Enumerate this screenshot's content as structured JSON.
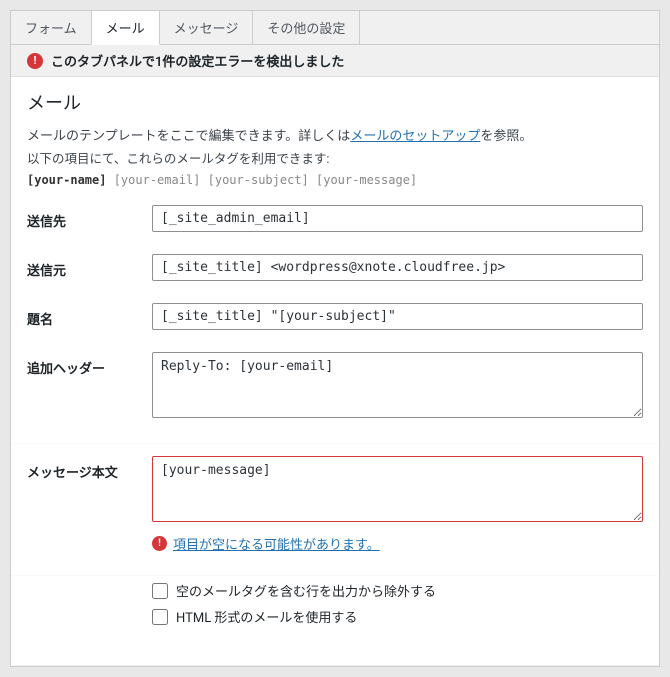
{
  "tabs": {
    "form": "フォーム",
    "mail": "メール",
    "messages": "メッセージ",
    "other": "その他の設定"
  },
  "alert": {
    "text": "このタブパネルで1件の設定エラーを検出しました"
  },
  "section": {
    "title": "メール",
    "intro_prefix": "メールのテンプレートをここで編集できます。詳しくは",
    "intro_link": "メールのセットアップ",
    "intro_suffix": "を参照。",
    "subintro": "以下の項目にて、これらのメールタグを利用できます:",
    "tag_first": "[your-name]",
    "tag_rest": " [your-email] [your-subject] [your-message]"
  },
  "fields": {
    "to": {
      "label": "送信先",
      "value": "[_site_admin_email]"
    },
    "from": {
      "label": "送信元",
      "value": "[_site_title] <wordpress@xnote.cloudfree.jp>"
    },
    "subject": {
      "label": "題名",
      "value": "[_site_title] \"[your-subject]\""
    },
    "headers": {
      "label": "追加ヘッダー",
      "value": "Reply-To: [your-email]"
    },
    "body": {
      "label": "メッセージ本文",
      "value": "[your-message]"
    }
  },
  "error": {
    "link": "項目が空になる可能性があります。"
  },
  "checks": {
    "exclude": "空のメールタグを含む行を出力から除外する",
    "html": "HTML 形式のメールを使用する"
  }
}
